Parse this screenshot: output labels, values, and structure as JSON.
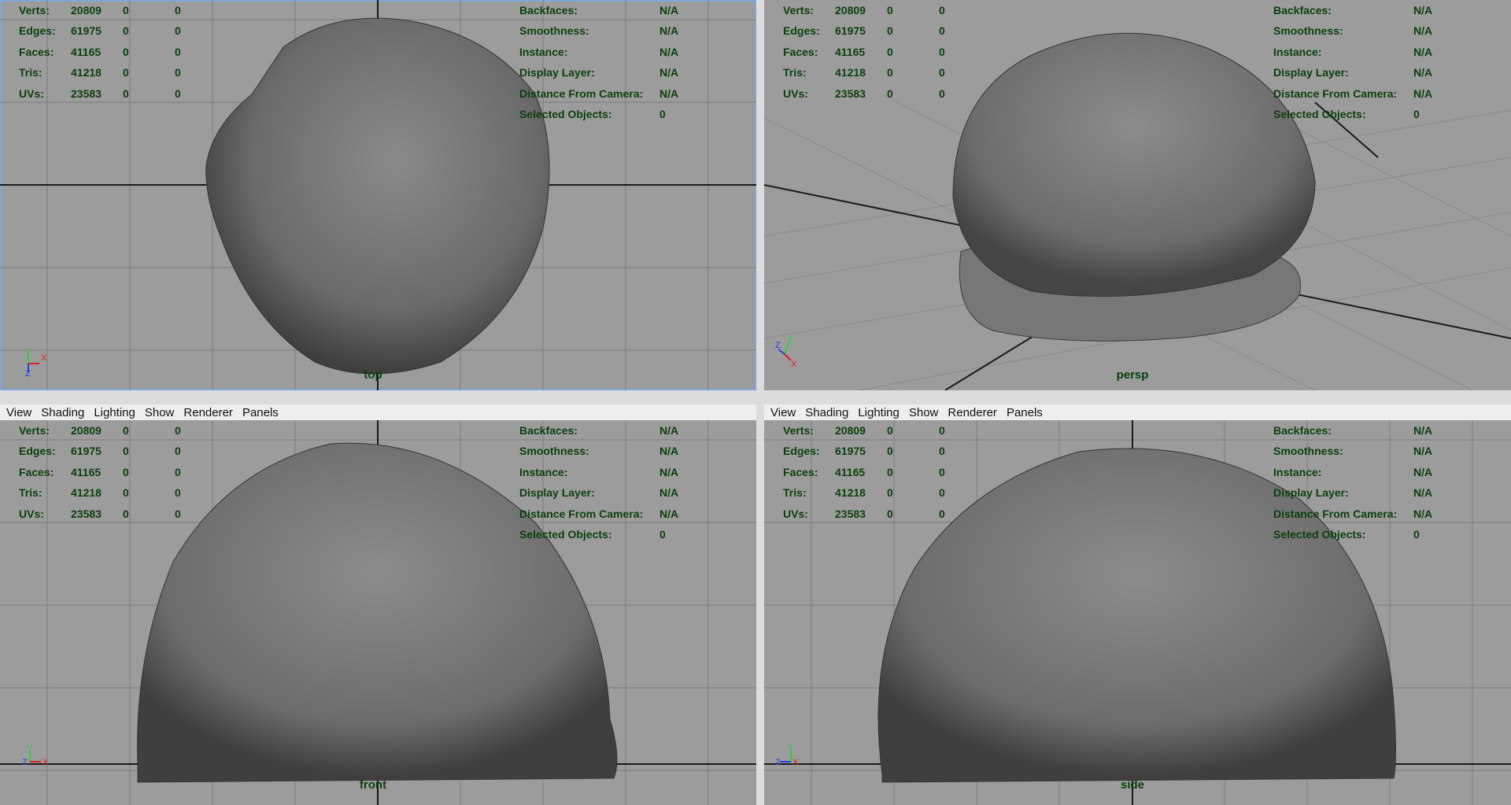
{
  "menu": [
    "View",
    "Shading",
    "Lighting",
    "Show",
    "Renderer",
    "Panels"
  ],
  "hud_left": [
    {
      "label": "Verts:",
      "v1": "20809",
      "v2": "0",
      "v3": "0"
    },
    {
      "label": "Edges:",
      "v1": "61975",
      "v2": "0",
      "v3": "0"
    },
    {
      "label": "Faces:",
      "v1": "41165",
      "v2": "0",
      "v3": "0"
    },
    {
      "label": "Tris:",
      "v1": "41218",
      "v2": "0",
      "v3": "0"
    },
    {
      "label": "UVs:",
      "v1": "23583",
      "v2": "0",
      "v3": "0"
    }
  ],
  "hud_right": [
    {
      "label": "Backfaces:",
      "value": "N/A"
    },
    {
      "label": "Smoothness:",
      "value": "N/A"
    },
    {
      "label": "Instance:",
      "value": "N/A"
    },
    {
      "label": "Display Layer:",
      "value": "N/A"
    },
    {
      "label": "Distance From Camera:",
      "value": "N/A"
    },
    {
      "label": "Selected Objects:",
      "value": "0"
    }
  ],
  "viewports": {
    "top": {
      "camera": "top"
    },
    "persp": {
      "camera": "persp"
    },
    "front": {
      "camera": "front"
    },
    "side": {
      "camera": "side"
    }
  },
  "axis_labels": {
    "x": "X",
    "y": "Y",
    "z": "Z"
  },
  "colors": {
    "viewport_bg": "#9c9c9c",
    "grid": "#7d7d7d",
    "hud_text": "#0b3f0b",
    "active_outline": "#7fa7d8",
    "mesh": "#6a6a6a"
  }
}
